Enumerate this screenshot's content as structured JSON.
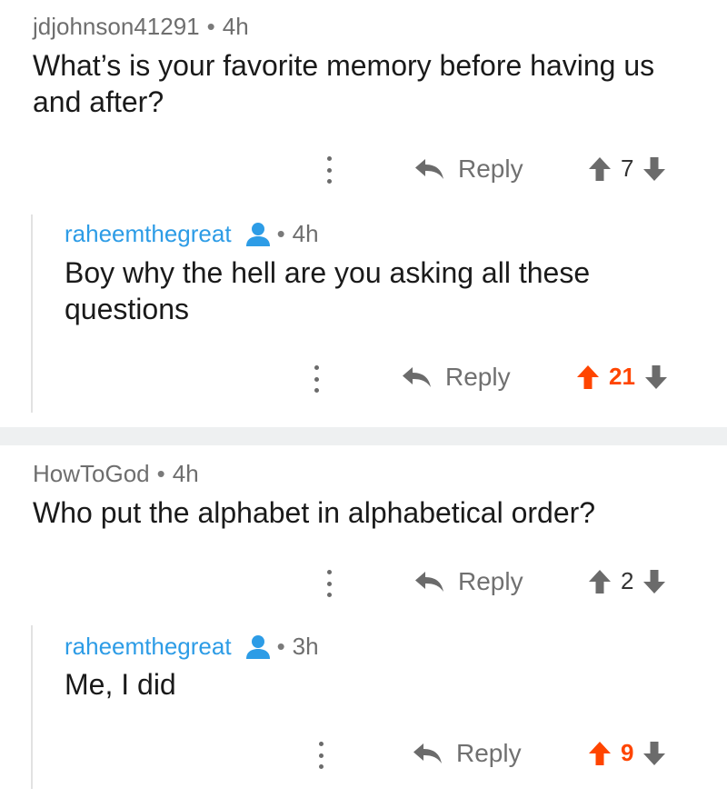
{
  "colors": {
    "upvote_active": "#ff4500",
    "username_reply": "#2d9ce6",
    "divider": "#eef0f1"
  },
  "threads": [
    {
      "comment": {
        "author": "jdjohnson41291",
        "age": "4h",
        "text": "What’s is your favorite memory before having us and after?",
        "reply_label": "Reply",
        "score": "7",
        "upvoted": false
      },
      "reply": {
        "author": "raheemthegreat",
        "age": "4h",
        "text": "Boy why the hell are you asking all these questions",
        "reply_label": "Reply",
        "score": "21",
        "upvoted": true
      }
    },
    {
      "comment": {
        "author": "HowToGod",
        "age": "4h",
        "text": "Who put the alphabet in alphabetical order?",
        "reply_label": "Reply",
        "score": "2",
        "upvoted": false
      },
      "reply": {
        "author": "raheemthegreat",
        "age": "3h",
        "text": "Me, I did",
        "reply_label": "Reply",
        "score": "9",
        "upvoted": true
      }
    }
  ],
  "separator": "•"
}
